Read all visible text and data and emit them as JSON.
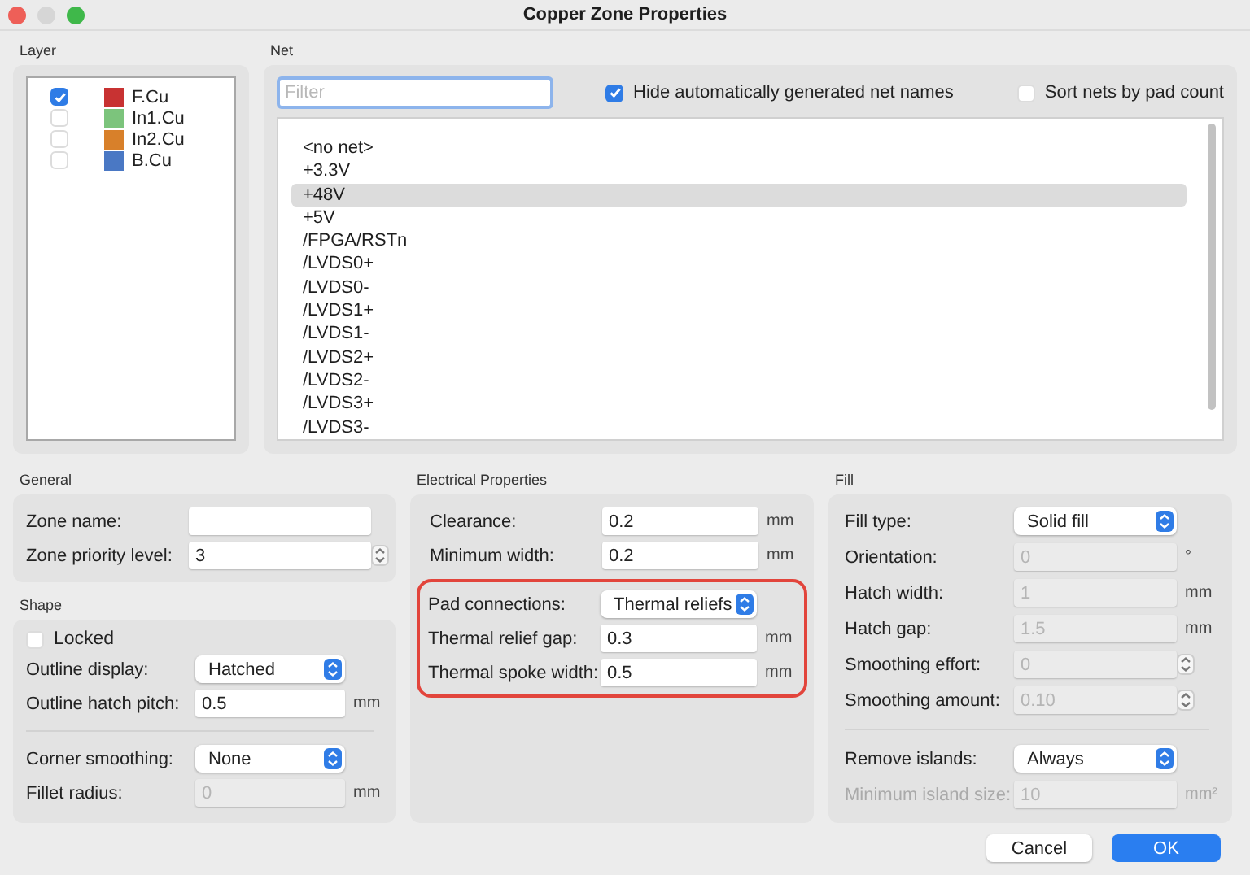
{
  "window": {
    "title": "Copper Zone Properties"
  },
  "layer": {
    "title": "Layer",
    "items": [
      {
        "name": "F.Cu",
        "checked": true,
        "color": "#c83232"
      },
      {
        "name": "In1.Cu",
        "checked": false,
        "color": "#7cc47c"
      },
      {
        "name": "In2.Cu",
        "checked": false,
        "color": "#d8802a"
      },
      {
        "name": "B.Cu",
        "checked": false,
        "color": "#4a78c4"
      }
    ]
  },
  "net": {
    "title": "Net",
    "filter": {
      "placeholder": "Filter"
    },
    "hide_auto": {
      "label": "Hide automatically generated net names",
      "checked": true
    },
    "sort_by_pad": {
      "label": "Sort nets by pad count",
      "checked": false
    },
    "items": [
      {
        "name": "<no net>",
        "selected": false
      },
      {
        "name": "+3.3V",
        "selected": false
      },
      {
        "name": "+48V",
        "selected": true
      },
      {
        "name": "+5V",
        "selected": false
      },
      {
        "name": "/FPGA/RSTn",
        "selected": false
      },
      {
        "name": "/LVDS0+",
        "selected": false
      },
      {
        "name": "/LVDS0-",
        "selected": false
      },
      {
        "name": "/LVDS1+",
        "selected": false
      },
      {
        "name": "/LVDS1-",
        "selected": false
      },
      {
        "name": "/LVDS2+",
        "selected": false
      },
      {
        "name": "/LVDS2-",
        "selected": false
      },
      {
        "name": "/LVDS3+",
        "selected": false
      },
      {
        "name": "/LVDS3-",
        "selected": false
      }
    ]
  },
  "general": {
    "title": "General",
    "rows": [
      {
        "kind": "text",
        "label": "Zone name:",
        "disabled": false
      },
      {
        "kind": "spin",
        "label": "Zone priority level:",
        "value": "3",
        "disabled": false
      }
    ]
  },
  "shape": {
    "title": "Shape",
    "rows": [
      {
        "kind": "check",
        "label": "Locked",
        "checked": false
      },
      {
        "kind": "select",
        "label": "Outline display:",
        "value": "Hatched"
      },
      {
        "kind": "text",
        "label": "Outline hatch pitch:",
        "value": "0.5",
        "unit": "mm",
        "disabled": false
      },
      {
        "kind": "divider"
      },
      {
        "kind": "select",
        "label": "Corner smoothing:",
        "value": "None"
      },
      {
        "kind": "text",
        "label": "Fillet radius:",
        "value": "0",
        "unit": "mm",
        "disabled": true
      }
    ]
  },
  "electrical": {
    "title": "Electrical Properties",
    "groups": [
      {
        "highlighted": false,
        "rows": [
          {
            "kind": "text",
            "label": "Clearance:",
            "value": "0.2",
            "unit": "mm",
            "disabled": false
          },
          {
            "kind": "text",
            "label": "Minimum width:",
            "value": "0.2",
            "unit": "mm",
            "disabled": false
          }
        ]
      },
      {
        "highlighted": true,
        "rows": [
          {
            "kind": "select",
            "label": "Pad connections:",
            "value": "Thermal reliefs"
          },
          {
            "kind": "text",
            "label": "Thermal relief gap:",
            "value": "0.3",
            "unit": "mm",
            "disabled": false
          },
          {
            "kind": "text",
            "label": "Thermal spoke width:",
            "value": "0.5",
            "unit": "mm",
            "disabled": false
          }
        ]
      }
    ]
  },
  "fill": {
    "title": "Fill",
    "rows": [
      {
        "kind": "select",
        "label": "Fill type:",
        "value": "Solid fill"
      },
      {
        "kind": "text",
        "label": "Orientation:",
        "value": "0",
        "unit": "°",
        "disabled": true
      },
      {
        "kind": "text",
        "label": "Hatch width:",
        "value": "1",
        "unit": "mm",
        "disabled": true
      },
      {
        "kind": "text",
        "label": "Hatch gap:",
        "value": "1.5",
        "unit": "mm",
        "disabled": true
      },
      {
        "kind": "spin",
        "label": "Smoothing effort:",
        "value": "0",
        "disabled": true
      },
      {
        "kind": "spin",
        "label": "Smoothing amount:",
        "value": "0.10",
        "disabled": true
      },
      {
        "kind": "divider"
      },
      {
        "kind": "select",
        "label": "Remove islands:",
        "value": "Always"
      },
      {
        "kind": "text",
        "label": "Minimum island size:",
        "value": "10",
        "unit": "mm²",
        "disabled": true,
        "label_disabled": true
      }
    ]
  },
  "buttons": [
    {
      "label": "Cancel",
      "kind": "secondary"
    },
    {
      "label": "OK",
      "kind": "primary"
    }
  ]
}
